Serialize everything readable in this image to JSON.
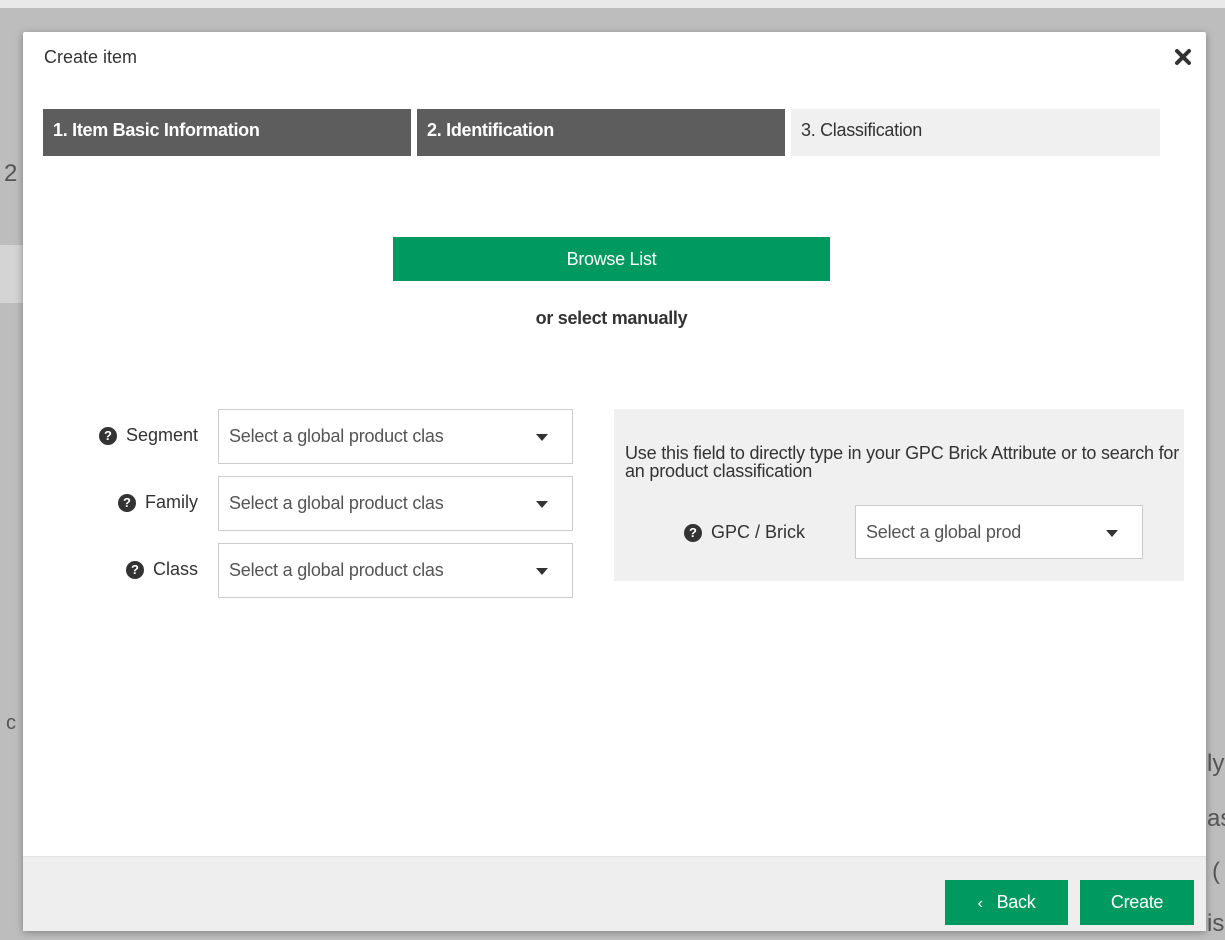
{
  "background": {
    "frag_digit": "2",
    "frag_c": "c",
    "frag_ly": "ly",
    "frag_as": "as",
    "frag_paren": "(",
    "frag_is": "is"
  },
  "modal": {
    "title": "Create item",
    "close_icon": "close-icon"
  },
  "steps": [
    {
      "label": "1. Item Basic Information",
      "state": "done"
    },
    {
      "label": "2. Identification",
      "state": "done"
    },
    {
      "label": "3. Classification",
      "state": "current"
    }
  ],
  "browse": {
    "button_label": "Browse List",
    "or_text": "or select manually"
  },
  "form": {
    "segment": {
      "label": "Segment",
      "placeholder": "Select a global product clas"
    },
    "family": {
      "label": "Family",
      "placeholder": "Select a global product clas"
    },
    "class": {
      "label": "Class",
      "placeholder": "Select a global product clas"
    }
  },
  "gpc": {
    "help_text": "Use this field to directly type in your GPC Brick Attribute or to search for an product classification",
    "label": "GPC / Brick",
    "placeholder": "Select a global prod"
  },
  "footer": {
    "back_label": "Back",
    "create_label": "Create"
  },
  "colors": {
    "accent": "#009a61",
    "step_done": "#5d5d5d",
    "step_current": "#f0f0f0"
  }
}
